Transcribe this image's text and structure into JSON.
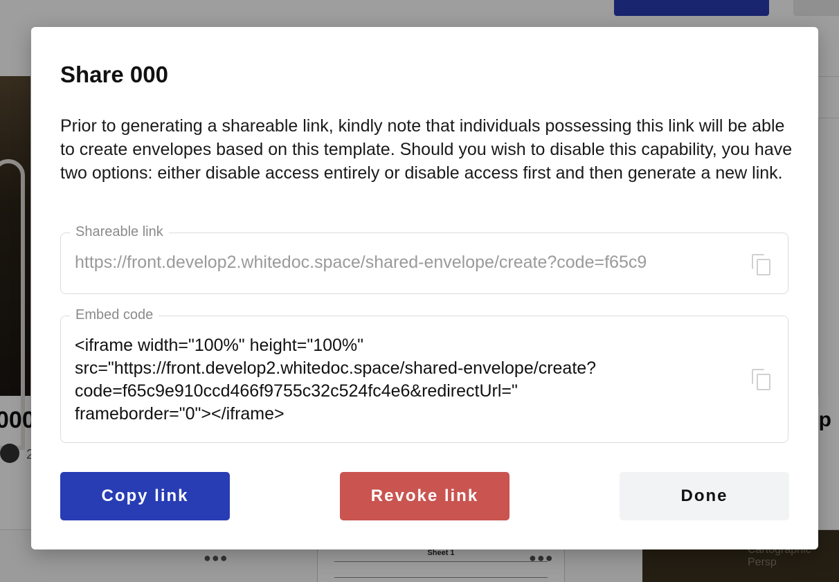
{
  "background": {
    "card_title": "000",
    "card_count": "2",
    "right_title": "ep",
    "sheet_label": "Sheet 1",
    "photo_text": "Cartographic Persp"
  },
  "modal": {
    "title": "Share 000",
    "description": "Prior to generating a shareable link, kindly note that individuals possessing this link will be able to create envelopes based on this template. Should you wish to disable this capability, you have two options: either disable access entirely or disable access first and then generate a new link.",
    "shareable_link": {
      "label": "Shareable link",
      "value": "https://front.develop2.whitedoc.space/shared-envelope/create?code=f65c9",
      "copy_icon": "copy-icon"
    },
    "embed_code": {
      "label": "Embed code",
      "value": "<iframe width=\"100%\" height=\"100%\"\nsrc=\"https://front.develop2.whitedoc.space/shared-envelope/create?\ncode=f65c9e910ccd466f9755c32c524fc4e6&redirectUrl=\"\nframeborder=\"0\"></iframe>",
      "copy_icon": "copy-icon"
    },
    "buttons": {
      "copy_label": "Copy link",
      "revoke_label": "Revoke link",
      "done_label": "Done"
    },
    "colors": {
      "copy": "#283db4",
      "revoke": "#c95450",
      "done": "#f2f3f5"
    }
  }
}
